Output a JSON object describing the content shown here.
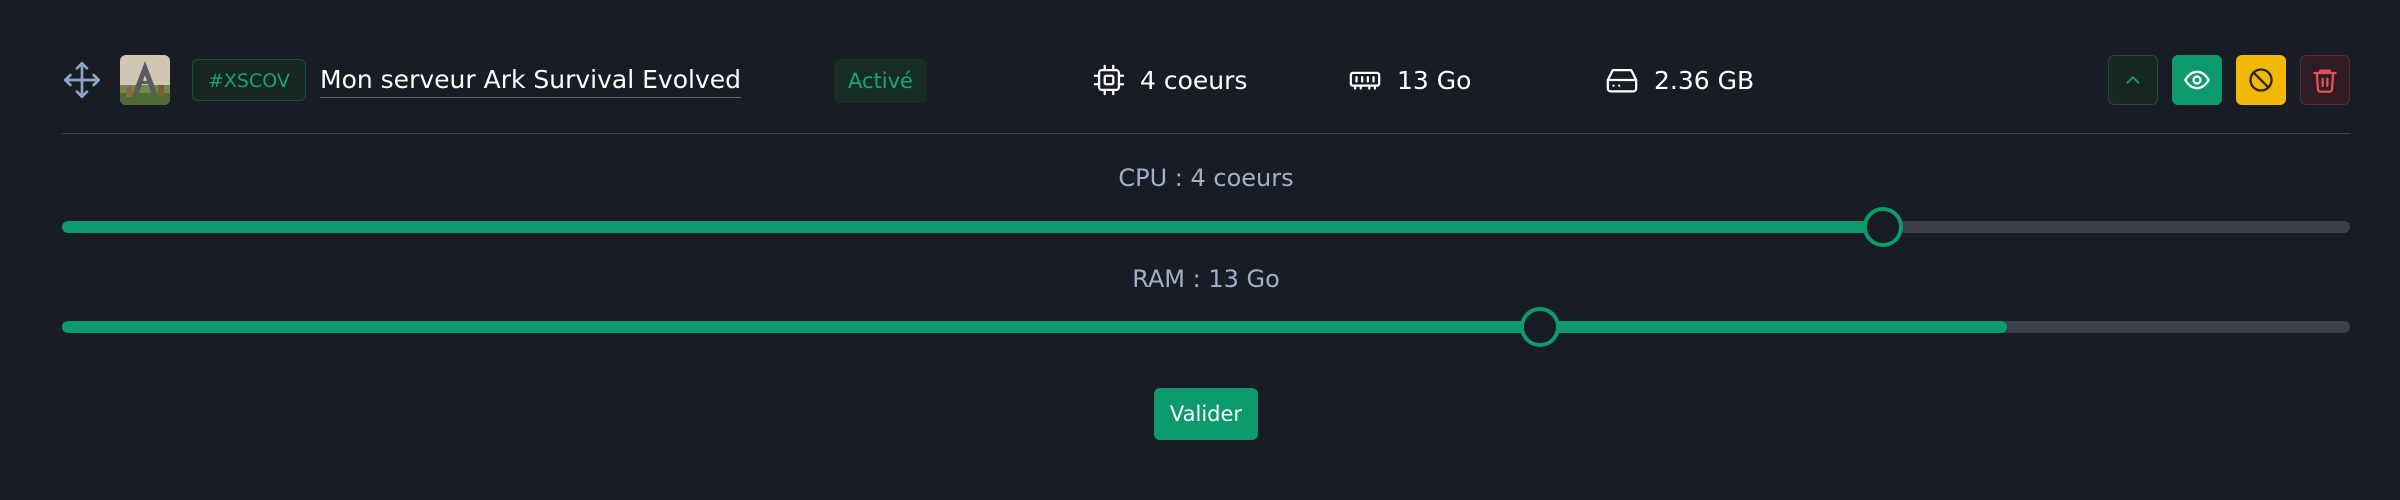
{
  "server": {
    "tag": "#XSCOV",
    "name": "Mon serveur Ark Survival Evolved",
    "status": "Activé",
    "thumbnail_icon": "ark-game-thumbnail"
  },
  "stats": {
    "cpu": "4 coeurs",
    "ram": "13 Go",
    "disk": "2.36 GB"
  },
  "actions": [
    {
      "name": "collapse-button",
      "icon": "chevron-up-icon"
    },
    {
      "name": "view-button",
      "icon": "eye-icon"
    },
    {
      "name": "suspend-button",
      "icon": "ban-icon"
    },
    {
      "name": "delete-button",
      "icon": "trash-icon"
    }
  ],
  "sliders": {
    "cpu": {
      "label": "CPU : 4 coeurs",
      "value_fraction": 0.796,
      "fill_fraction": 0.796
    },
    "ram": {
      "label": "RAM : 13 Go",
      "value_fraction": 0.646,
      "fill_fraction": 0.85
    }
  },
  "submit_label": "Valider",
  "colors": {
    "background": "#181c25",
    "accent": "#0e9a6d",
    "warning": "#f2b807",
    "danger": "#e0515a"
  }
}
